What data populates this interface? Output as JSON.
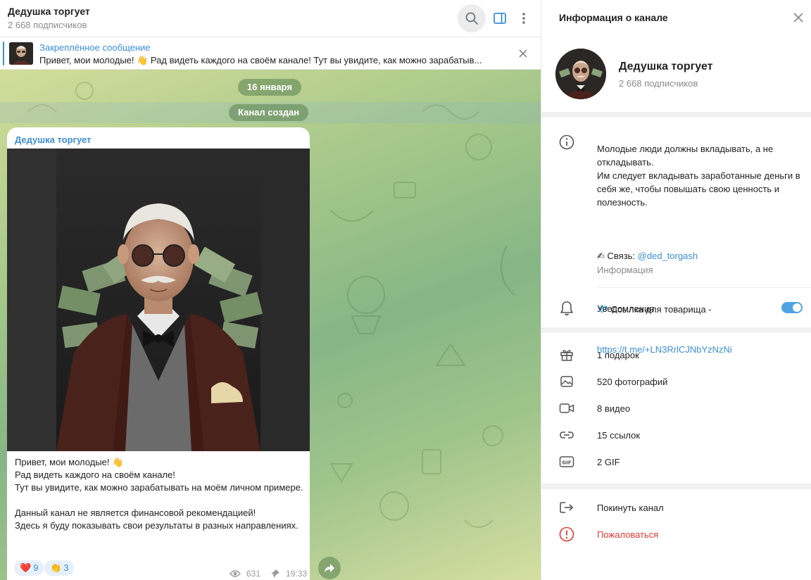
{
  "chat": {
    "title": "Дедушка торгует",
    "subscribers": "2 668 подписчиков",
    "pinned": {
      "label": "Закреплённое сообщение",
      "text": "Привет, мои молодые! 👋 Рад видеть каждого на своём канале!  Тут вы увидите, как можно зарабатыв..."
    },
    "date_pill": "16 января",
    "created_pill": "Канал создан",
    "message": {
      "author": "Дедушка торгует",
      "text": "Привет, мои молодые! 👋\nРад видеть каждого на своём канале!\nТут вы увидите, как можно зарабатывать на моём личном примере.\n\nДанный канал не является финансовой рекомендацией!\nЗдесь я буду показывать свои результаты в разных направлениях.",
      "reactions": [
        {
          "emoji": "❤️",
          "count": "9"
        },
        {
          "emoji": "👏",
          "count": "3"
        }
      ],
      "views": "631",
      "time": "19:33"
    }
  },
  "info": {
    "title": "Информация о канале",
    "name": "Дедушка торгует",
    "subscribers": "2 668 подписчиков",
    "description_main": "Молодые люди должны вкладывать, а не откладывать.\nИм следует вкладывать заработанные деньги в себя же, чтобы повышать свою ценность и полезность.",
    "contact_prefix": "✍ Связь: ",
    "contact_handle": "@ded_torgash",
    "link_prefix": "💎 Ссылка для товарища -",
    "link_url": "https://t.me/+LN3RrlCJNbYzNzNi",
    "description_caption": "Информация",
    "notifications_label": "Уведомления",
    "notifications_on": true,
    "media": {
      "gifts": "1 подарок",
      "photos": "520 фотографий",
      "videos": "8 видео",
      "links": "15 ссылок",
      "gifs": "2 GIF"
    },
    "leave": "Покинуть канал",
    "report": "Пожаловаться"
  },
  "colors": {
    "accent": "#3a8fd6",
    "danger": "#e53935"
  }
}
